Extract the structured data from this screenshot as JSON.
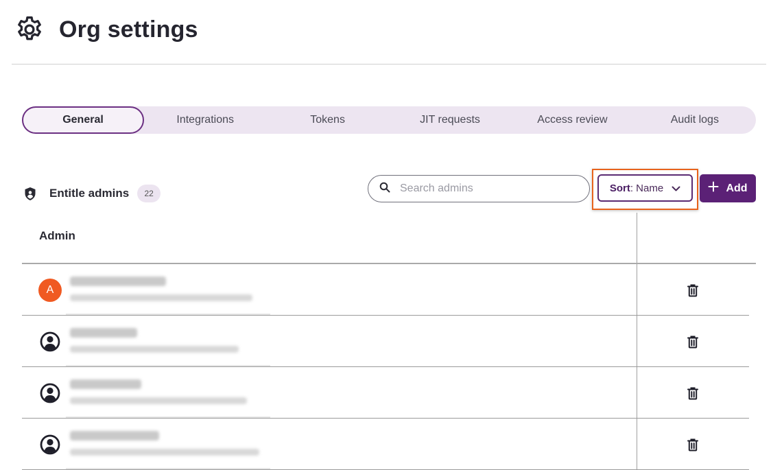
{
  "page": {
    "title": "Org settings",
    "icon": "gear-icon"
  },
  "tabs": [
    {
      "label": "General",
      "active": true
    },
    {
      "label": "Integrations",
      "active": false
    },
    {
      "label": "Tokens",
      "active": false
    },
    {
      "label": "JIT requests",
      "active": false
    },
    {
      "label": "Access review",
      "active": false
    },
    {
      "label": "Audit logs",
      "active": false
    }
  ],
  "section": {
    "title": "Entitle admins",
    "icon": "shield-icon",
    "count": "22"
  },
  "search": {
    "placeholder": "Search admins",
    "value": ""
  },
  "sort": {
    "key_label": "Sort",
    "value": "Name"
  },
  "add_button": {
    "label": "Add"
  },
  "table": {
    "columns": [
      "Admin",
      ""
    ],
    "rows": [
      {
        "avatar": "A",
        "avatar_color": "#f05a22",
        "name": "",
        "email": "",
        "action_icon": "trash-icon"
      },
      {
        "avatar": "",
        "avatar_color": "",
        "name": "",
        "email": "",
        "action_icon": "trash-icon"
      },
      {
        "avatar": "",
        "avatar_color": "",
        "name": "",
        "email": "",
        "action_icon": "trash-icon"
      },
      {
        "avatar": "",
        "avatar_color": "",
        "name": "",
        "email": "",
        "action_icon": "trash-icon"
      }
    ]
  },
  "colors": {
    "brand": "#5b2176",
    "highlight": "#e8631c",
    "tab_bar": "#ede5f1"
  }
}
